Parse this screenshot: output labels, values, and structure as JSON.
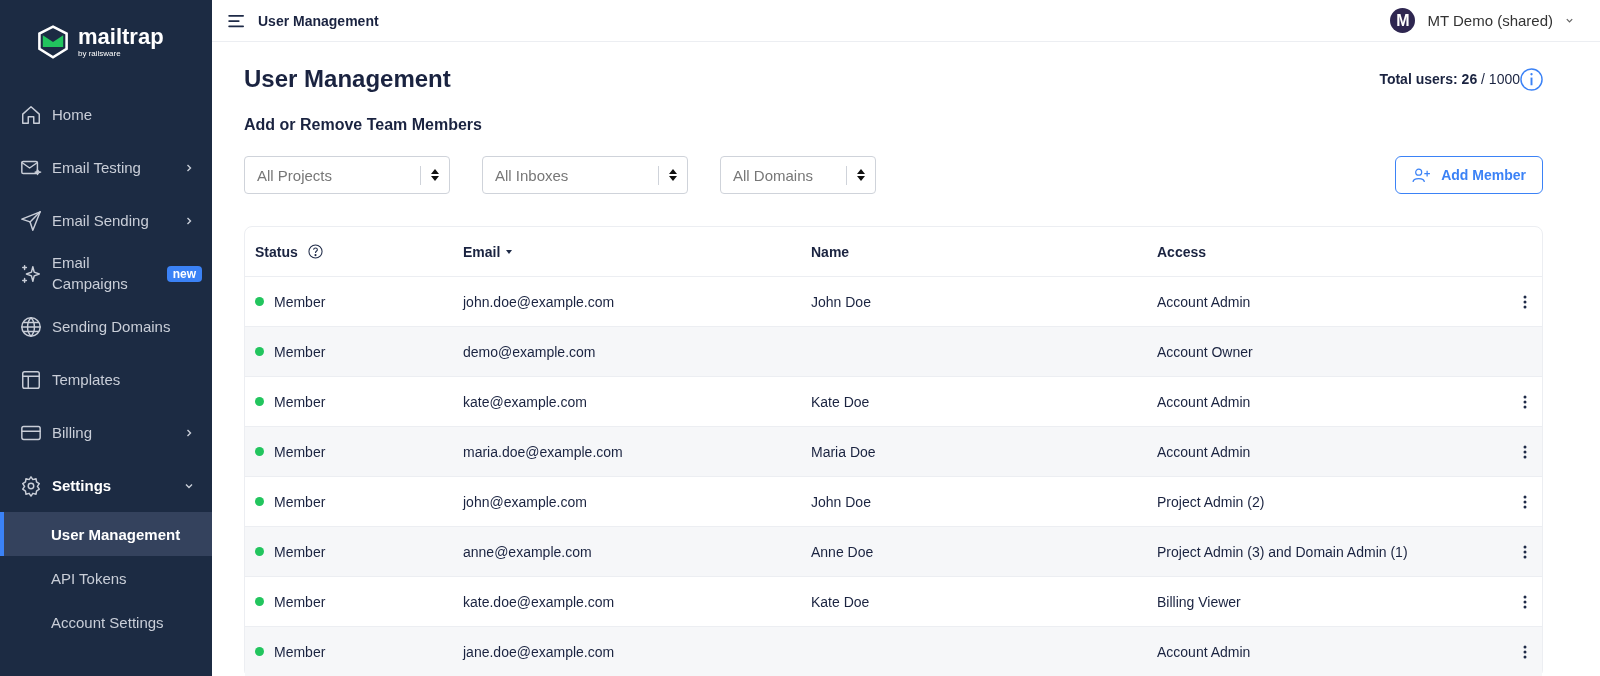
{
  "sidebar": {
    "logo": {
      "name": "mailtrap",
      "tagline": "by railsware"
    },
    "items": [
      {
        "label": "Home",
        "kind": "home",
        "selected": false,
        "expandable": false,
        "expanded": false
      },
      {
        "label": "Email Testing",
        "kind": "envelope",
        "selected": false,
        "expandable": true,
        "expanded": false
      },
      {
        "label": "Email Sending",
        "kind": "plane",
        "selected": false,
        "expandable": true,
        "expanded": false
      },
      {
        "label": "Email Campaigns",
        "kind": "sparkle",
        "selected": false,
        "expandable": false,
        "expanded": false,
        "badge": "new"
      },
      {
        "label": "Sending Domains",
        "kind": "globe",
        "selected": false,
        "expandable": false,
        "expanded": false
      },
      {
        "label": "Templates",
        "kind": "layout",
        "selected": false,
        "expandable": false,
        "expanded": false
      },
      {
        "label": "Billing",
        "kind": "card",
        "selected": false,
        "expandable": true,
        "expanded": false
      },
      {
        "label": "Settings",
        "kind": "gear",
        "selected": false,
        "expandable": true,
        "expanded": true,
        "children": [
          {
            "label": "User Management",
            "selected": true
          },
          {
            "label": "API Tokens",
            "selected": false
          },
          {
            "label": "Account Settings",
            "selected": false
          }
        ]
      }
    ]
  },
  "topbar": {
    "title": "User Management",
    "account": {
      "avatar": "M",
      "name": "MT Demo (shared)"
    }
  },
  "page": {
    "title": "User Management",
    "total_users": "**Total users: 26** / 1000",
    "subtitle": "Add or Remove Team Members",
    "filters": [
      {
        "placeholder": "All Projects"
      },
      {
        "placeholder": "All Inboxes"
      },
      {
        "placeholder": "All Domains"
      }
    ],
    "add_button": "Add Member"
  },
  "table": {
    "columns": [
      {
        "label": "Status",
        "help": true
      },
      {
        "label": "Email",
        "sorted": true
      },
      {
        "label": "Name"
      },
      {
        "label": "Access"
      }
    ],
    "rows": [
      {
        "status": "Member",
        "color": "#22c55e",
        "email": "john.doe@example.com",
        "name": "John Doe",
        "access": "Account Admin",
        "has_menu": true
      },
      {
        "status": "Member",
        "color": "#22c55e",
        "email": "demo@example.com",
        "access": "Account Owner",
        "has_menu": false
      },
      {
        "status": "Member",
        "color": "#22c55e",
        "email": "kate@example.com",
        "name": "Kate Doe",
        "access": "Account Admin",
        "has_menu": true
      },
      {
        "status": "Member",
        "color": "#22c55e",
        "email": "maria.doe@example.com",
        "name": "Maria Doe",
        "access": "Account Admin",
        "has_menu": true
      },
      {
        "status": "Member",
        "color": "#22c55e",
        "email": "john@example.com",
        "name": "John Doe",
        "access": "Project Admin (2)",
        "has_menu": true
      },
      {
        "status": "Member",
        "color": "#22c55e",
        "email": "anne@example.com",
        "name": "Anne Doe",
        "access": "Project Admin (3) and Domain Admin (1)",
        "has_menu": true
      },
      {
        "status": "Member",
        "color": "#22c55e",
        "email": "kate.doe@example.com",
        "name": "Kate Doe",
        "access": "Billing Viewer",
        "has_menu": true
      },
      {
        "status": "Member",
        "color": "#22c55e",
        "email": "jane.doe@example.com",
        "access": "Account Admin",
        "has_menu": true
      }
    ]
  }
}
